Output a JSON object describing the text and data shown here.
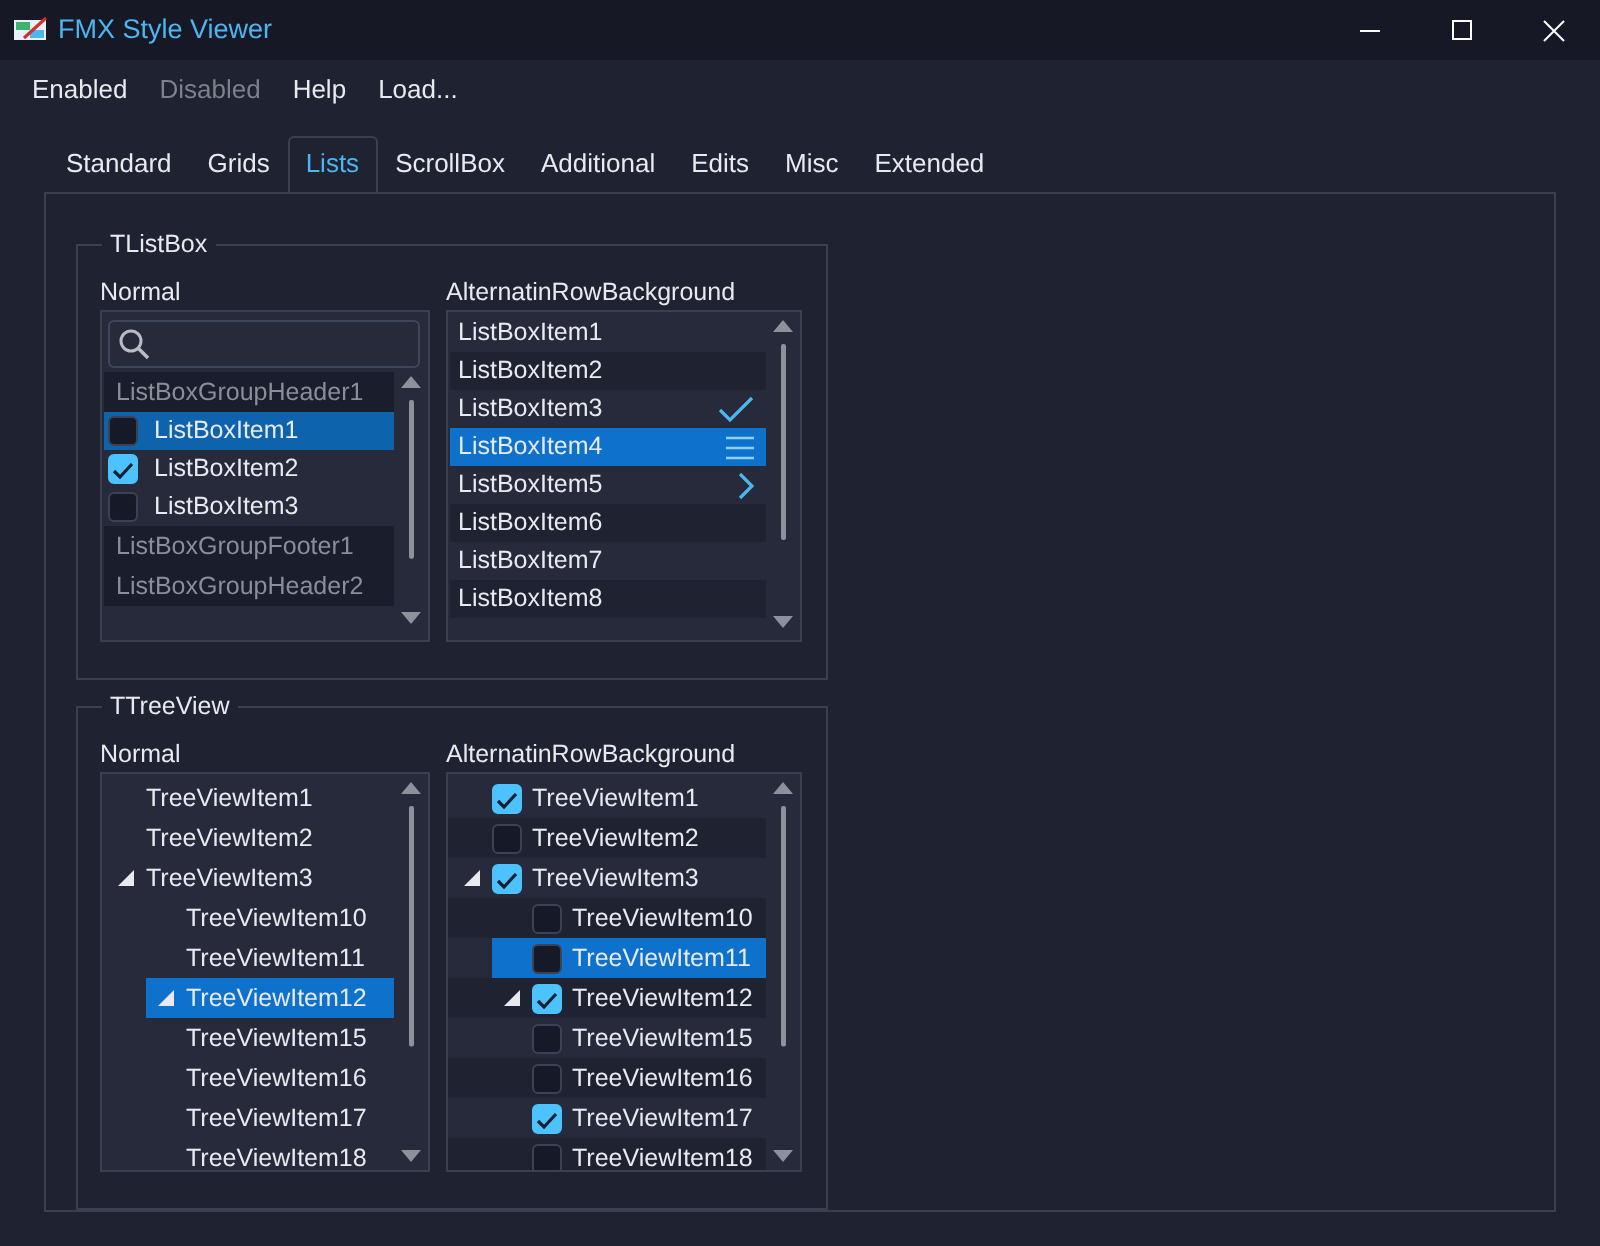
{
  "window": {
    "title": "FMX Style Viewer"
  },
  "menu": [
    {
      "label": "Enabled",
      "disabled": false
    },
    {
      "label": "Disabled",
      "disabled": true
    },
    {
      "label": "Help",
      "disabled": false
    },
    {
      "label": "Load...",
      "disabled": false
    }
  ],
  "tabs": [
    {
      "label": "Standard",
      "selected": false
    },
    {
      "label": "Grids",
      "selected": false
    },
    {
      "label": "Lists",
      "selected": true
    },
    {
      "label": "ScrollBox",
      "selected": false
    },
    {
      "label": "Additional",
      "selected": false
    },
    {
      "label": "Edits",
      "selected": false
    },
    {
      "label": "Misc",
      "selected": false
    },
    {
      "label": "Extended",
      "selected": false
    }
  ],
  "groups": [
    {
      "title": "TListBox",
      "panels": [
        {
          "label": "Normal",
          "kind": "grouped-list",
          "alternating_rows": false,
          "items": [
            {
              "kind": "header",
              "text": "ListBoxGroupHeader1"
            },
            {
              "kind": "item",
              "text": "ListBoxItem1",
              "checked": false,
              "selected": true
            },
            {
              "kind": "item",
              "text": "ListBoxItem2",
              "checked": true,
              "selected": false
            },
            {
              "kind": "item",
              "text": "ListBoxItem3",
              "checked": false,
              "selected": false
            },
            {
              "kind": "footer",
              "text": "ListBoxGroupFooter1"
            },
            {
              "kind": "header",
              "text": "ListBoxGroupHeader2"
            }
          ]
        },
        {
          "label": "AlternatinRowBackground",
          "kind": "list",
          "alternating_rows": true,
          "items": [
            {
              "kind": "plain",
              "text": "ListBoxItem1",
              "selected": false
            },
            {
              "kind": "plain",
              "text": "ListBoxItem2",
              "selected": false
            },
            {
              "kind": "checkmark",
              "text": "ListBoxItem3",
              "selected": false
            },
            {
              "kind": "detail",
              "text": "ListBoxItem4",
              "selected": true
            },
            {
              "kind": "more",
              "text": "ListBoxItem5",
              "selected": false
            },
            {
              "kind": "plain",
              "text": "ListBoxItem6",
              "selected": false
            },
            {
              "kind": "plain",
              "text": "ListBoxItem7",
              "selected": false
            },
            {
              "kind": "plain",
              "text": "ListBoxItem8",
              "selected": false
            }
          ]
        }
      ]
    },
    {
      "title": "TTreeView",
      "panels": [
        {
          "label": "Normal",
          "kind": "tree",
          "items": [
            {
              "text": "TreeViewItem1",
              "selected": false
            },
            {
              "text": "TreeViewItem2",
              "selected": false
            },
            {
              "text": "TreeViewItem3",
              "selected": false,
              "expanded": true,
              "children": [
                {
                  "text": "TreeViewItem10",
                  "selected": false
                },
                {
                  "text": "TreeViewItem11",
                  "selected": false
                },
                {
                  "text": "TreeViewItem12",
                  "selected": true,
                  "expanded": true
                },
                {
                  "text": "TreeViewItem15",
                  "selected": false
                },
                {
                  "text": "TreeViewItem16",
                  "selected": false
                },
                {
                  "text": "TreeViewItem17",
                  "selected": false
                },
                {
                  "text": "TreeViewItem18",
                  "selected": false
                }
              ]
            }
          ]
        },
        {
          "label": "AlternatinRowBackground",
          "kind": "striped-tree",
          "items": [
            {
              "text": "TreeViewItem1",
              "selected": false,
              "checked": true
            },
            {
              "text": "TreeViewItem2",
              "selected": false,
              "checked": false
            },
            {
              "text": "TreeViewItem3",
              "selected": false,
              "checked": true,
              "expanded": true,
              "children": [
                {
                  "text": "TreeViewItem10",
                  "selected": false,
                  "checked": false
                },
                {
                  "text": "TreeViewItem11",
                  "selected": true,
                  "checked": false
                },
                {
                  "text": "TreeViewItem12",
                  "selected": false,
                  "checked": true,
                  "expanded": true
                },
                {
                  "text": "TreeViewItem15",
                  "selected": false,
                  "checked": false
                },
                {
                  "text": "TreeViewItem16",
                  "selected": false,
                  "checked": false
                },
                {
                  "text": "TreeViewItem17",
                  "selected": false,
                  "checked": true
                },
                {
                  "text": "TreeViewItem18",
                  "selected": false,
                  "checked": false
                }
              ]
            }
          ]
        }
      ]
    }
  ]
}
